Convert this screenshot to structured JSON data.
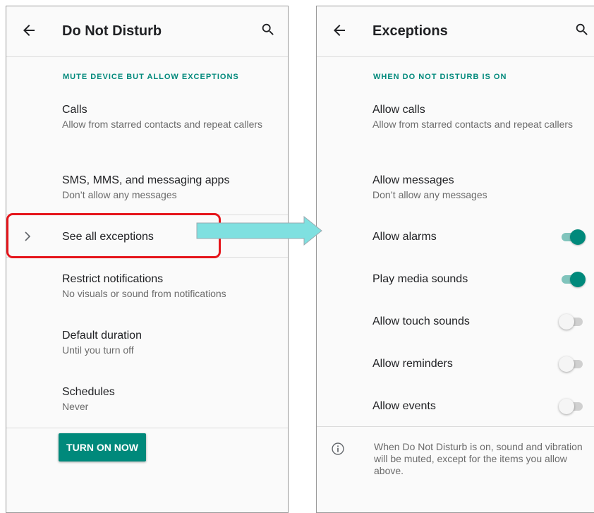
{
  "left": {
    "title": "Do Not Disturb",
    "section_header": "MUTE DEVICE BUT ALLOW EXCEPTIONS",
    "items": [
      {
        "title": "Calls",
        "subtitle": "Allow from starred contacts and repeat callers"
      },
      {
        "title": "SMS, MMS, and messaging apps",
        "subtitle": "Don’t allow any messages"
      },
      {
        "title": "See all exceptions"
      },
      {
        "title": "Restrict notifications",
        "subtitle": "No visuals or sound from notifications"
      },
      {
        "title": "Default duration",
        "subtitle": "Until you turn off"
      },
      {
        "title": "Schedules",
        "subtitle": "Never"
      }
    ],
    "button_label": "TURN ON NOW"
  },
  "right": {
    "title": "Exceptions",
    "section_header": "WHEN DO NOT DISTURB IS ON",
    "items": [
      {
        "title": "Allow calls",
        "subtitle": "Allow from starred contacts and repeat callers"
      },
      {
        "title": "Allow messages",
        "subtitle": "Don’t allow any messages"
      }
    ],
    "toggles": [
      {
        "label": "Allow alarms",
        "on": true
      },
      {
        "label": "Play media sounds",
        "on": true
      },
      {
        "label": "Allow touch sounds",
        "on": false
      },
      {
        "label": "Allow reminders",
        "on": false
      },
      {
        "label": "Allow events",
        "on": false
      }
    ],
    "info_text": "When Do Not Disturb is on, sound and vibration will be muted, except for the items you allow above."
  },
  "icons": {
    "back": "arrow-back-icon",
    "search": "search-icon",
    "chevron": "chevron-right-icon",
    "info": "info-icon"
  },
  "colors": {
    "accent": "#00897b",
    "highlight": "#e5151b",
    "arrow": "#7fe0e0"
  }
}
